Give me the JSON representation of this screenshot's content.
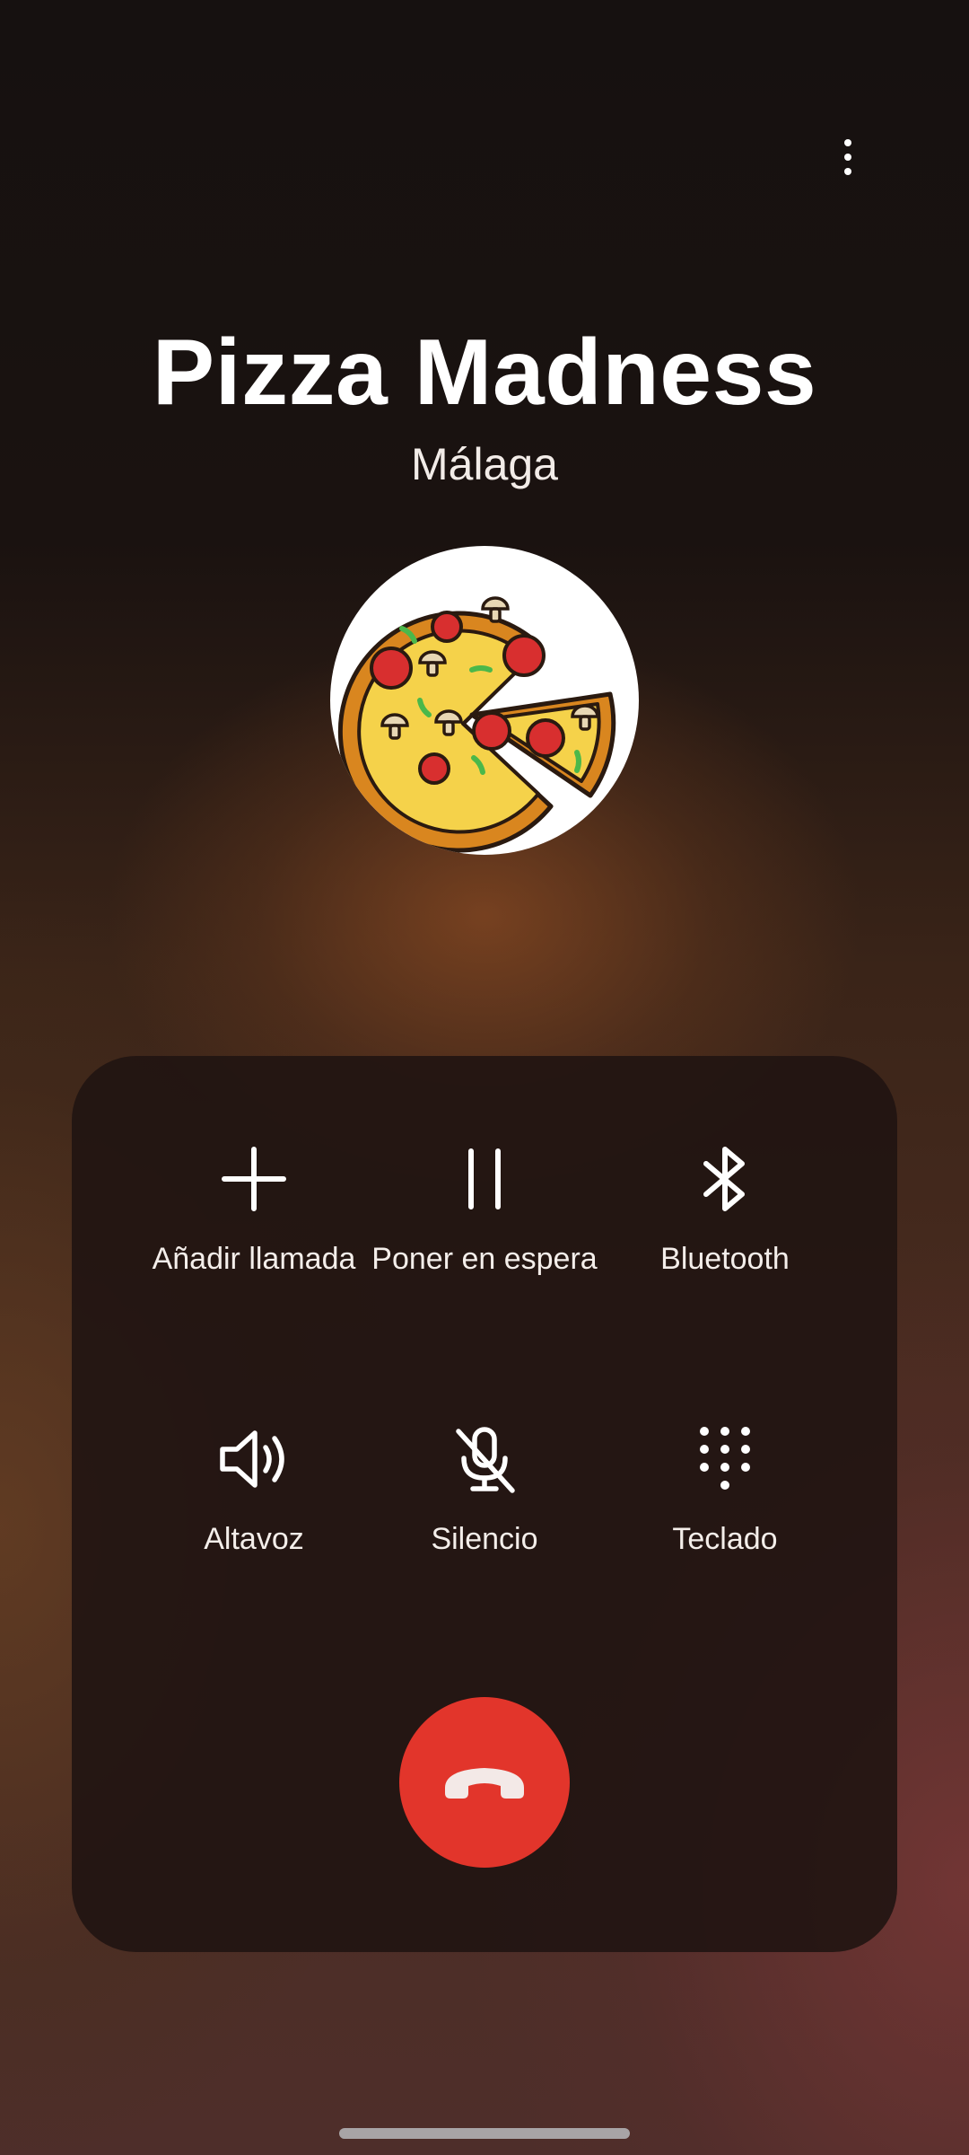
{
  "caller": {
    "name": "Pizza Madness",
    "location": "Málaga"
  },
  "actions": {
    "add_call": {
      "label": "Añadir llamada",
      "icon": "plus-icon"
    },
    "hold": {
      "label": "Poner en espera",
      "icon": "pause-icon"
    },
    "bluetooth": {
      "label": "Bluetooth",
      "icon": "bluetooth-icon"
    },
    "speaker": {
      "label": "Altavoz",
      "icon": "speaker-icon"
    },
    "mute": {
      "label": "Silencio",
      "icon": "mic-off-icon"
    },
    "keypad": {
      "label": "Teclado",
      "icon": "dialpad-icon"
    }
  },
  "end_call": {
    "icon": "hang-up-icon",
    "color": "#e2352b"
  },
  "colors": {
    "background_dark": "#161110",
    "panel": "#201412",
    "text": "#ffffff"
  }
}
